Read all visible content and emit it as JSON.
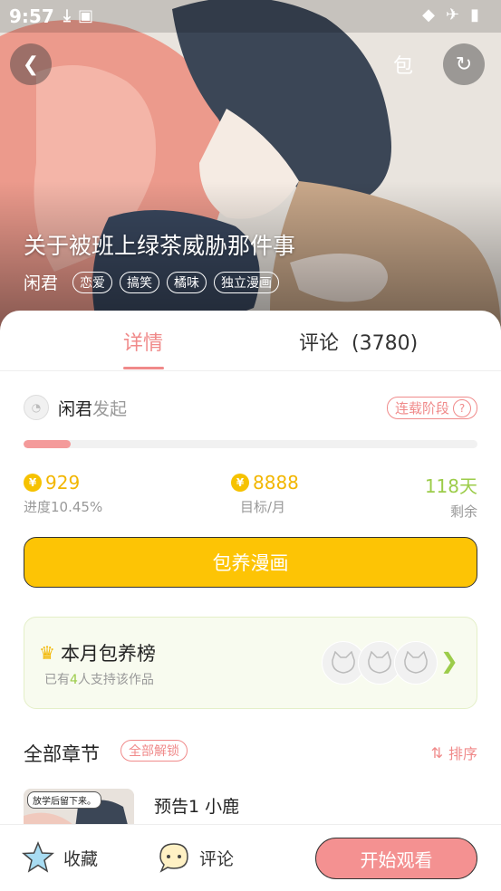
{
  "status_bar": {
    "time": "9:57"
  },
  "comic": {
    "title": "关于被班上绿茶威胁那件事",
    "author": "闲君",
    "tags": [
      "恋爱",
      "搞笑",
      "橘味",
      "独立漫画"
    ]
  },
  "header": {
    "support_label": "包"
  },
  "tabs": {
    "details": "详情",
    "comments": "评论",
    "comment_count": "(3780)"
  },
  "campaign": {
    "initiator_name": "闲君",
    "initiator_suffix": "发起",
    "stage_label": "连载阶段",
    "stage_help": "?",
    "progress_fraction": 0.1045,
    "raised": "929",
    "raised_label": "进度10.45%",
    "target": "8888",
    "target_label": "目标/月",
    "days_left": "118天",
    "days_left_label": "剩余",
    "button_label": "包养漫画"
  },
  "ranking": {
    "title": "本月包养榜",
    "subtitle_prefix": "已有",
    "supporter_count": "4",
    "subtitle_suffix": "人支持该作品"
  },
  "chapters": {
    "heading": "全部章节",
    "unlock_all": "全部解锁",
    "sort_label": "排序",
    "items": [
      {
        "title": "预告1 小鹿",
        "thumb_text": "放学后留下来。"
      }
    ]
  },
  "bottom_bar": {
    "favorite": "收藏",
    "comment": "评论",
    "start_reading": "开始观看"
  },
  "colors": {
    "accent": "#f08a8a",
    "gold": "#f2b600",
    "green": "#9ccc4a",
    "button_yellow": "#fdc405"
  }
}
